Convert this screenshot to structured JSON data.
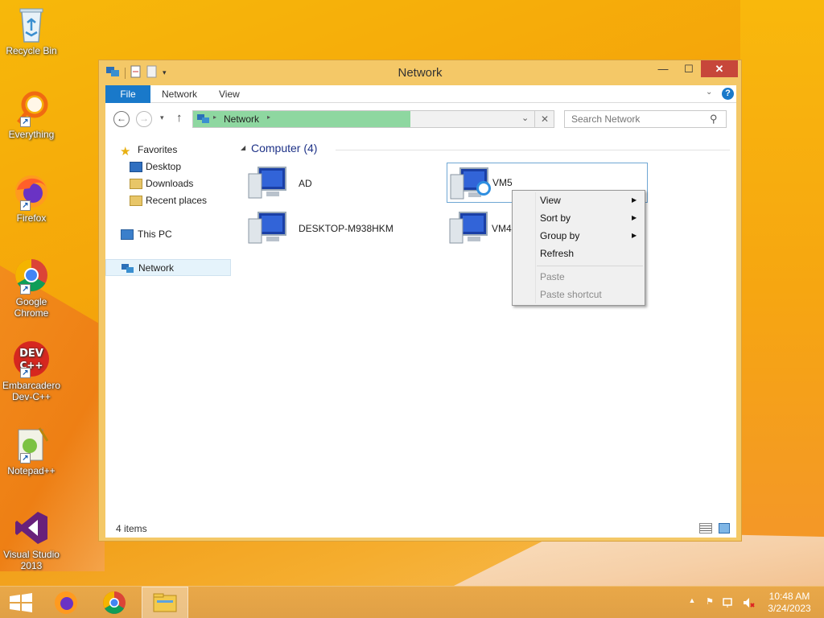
{
  "desktop": {
    "icons": [
      {
        "label": "Recycle Bin",
        "icon": "recycle-bin-icon"
      },
      {
        "label": "Everything",
        "icon": "everything-search-icon"
      },
      {
        "label": "Firefox",
        "icon": "firefox-icon"
      },
      {
        "label": "Google Chrome",
        "icon": "chrome-icon"
      },
      {
        "label": "Embarcadero Dev-C++",
        "icon": "devcpp-icon",
        "badge": "DEV C++"
      },
      {
        "label": "Notepad++",
        "icon": "notepadpp-icon"
      },
      {
        "label": "Visual Studio 2013",
        "icon": "visual-studio-icon"
      }
    ]
  },
  "window": {
    "title": "Network",
    "controls": {
      "minimize": "—",
      "maximize": "☐",
      "close": "✕"
    },
    "ribbon": {
      "file": "File",
      "network": "Network",
      "view": "View"
    },
    "address": {
      "location": "Network"
    },
    "search": {
      "placeholder": "Search Network"
    },
    "nav": {
      "favorites": "Favorites",
      "desktop": "Desktop",
      "downloads": "Downloads",
      "recent": "Recent places",
      "this_pc": "This PC",
      "network": "Network"
    },
    "group": {
      "title": "Computer (4)"
    },
    "items": [
      {
        "label": "AD"
      },
      {
        "label": "VM5"
      },
      {
        "label": "DESKTOP-M938HKM"
      },
      {
        "label": "VM4"
      }
    ],
    "status": {
      "count": "4 items"
    }
  },
  "context_menu": {
    "view": "View",
    "sort_by": "Sort by",
    "group_by": "Group by",
    "refresh": "Refresh",
    "paste": "Paste",
    "paste_shortcut": "Paste shortcut"
  },
  "taskbar": {
    "time": "10:48 AM",
    "date": "3/24/2023"
  },
  "colors": {
    "accent": "#1979ca",
    "window_frame": "#f4c867",
    "close_button": "#c7473a",
    "address_fill": "#8ed7a0"
  }
}
